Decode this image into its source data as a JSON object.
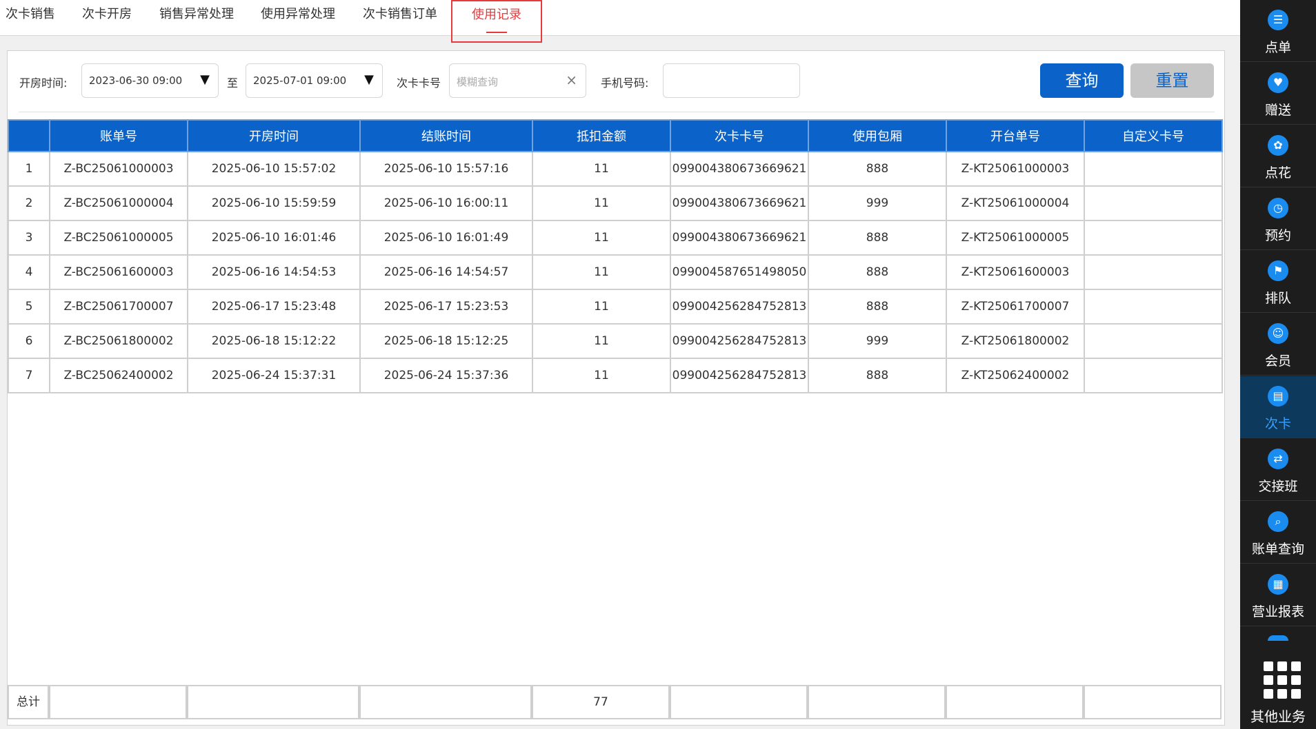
{
  "tabs": [
    {
      "label": "次卡销售"
    },
    {
      "label": "次卡开房"
    },
    {
      "label": "销售异常处理"
    },
    {
      "label": "使用异常处理"
    },
    {
      "label": "次卡销售订单"
    },
    {
      "label": "使用记录"
    }
  ],
  "filters": {
    "open_time_label": "开房时间:",
    "start": "2023-06-30 09:00",
    "to": "至",
    "end": "2025-07-01 09:00",
    "card_label": "次卡卡号",
    "card_placeholder": "模糊查询",
    "phone_label": "手机号码:",
    "phone_value": "",
    "query_label": "查询",
    "reset_label": "重置"
  },
  "table": {
    "columns": [
      "",
      "账单号",
      "开房时间",
      "结账时间",
      "抵扣金额",
      "次卡卡号",
      "使用包厢",
      "开台单号",
      "自定义卡号"
    ],
    "rows": [
      [
        "1",
        "Z-BC25061000003",
        "2025-06-10 15:57:02",
        "2025-06-10 15:57:16",
        "11",
        "099004380673669621",
        "888",
        "Z-KT25061000003",
        ""
      ],
      [
        "2",
        "Z-BC25061000004",
        "2025-06-10 15:59:59",
        "2025-06-10 16:00:11",
        "11",
        "099004380673669621",
        "999",
        "Z-KT25061000004",
        ""
      ],
      [
        "3",
        "Z-BC25061000005",
        "2025-06-10 16:01:46",
        "2025-06-10 16:01:49",
        "11",
        "099004380673669621",
        "888",
        "Z-KT25061000005",
        ""
      ],
      [
        "4",
        "Z-BC25061600003",
        "2025-06-16 14:54:53",
        "2025-06-16 14:54:57",
        "11",
        "099004587651498050",
        "888",
        "Z-KT25061600003",
        ""
      ],
      [
        "5",
        "Z-BC25061700007",
        "2025-06-17 15:23:48",
        "2025-06-17 15:23:53",
        "11",
        "099004256284752813",
        "888",
        "Z-KT25061700007",
        ""
      ],
      [
        "6",
        "Z-BC25061800002",
        "2025-06-18 15:12:22",
        "2025-06-18 15:12:25",
        "11",
        "099004256284752813",
        "999",
        "Z-KT25061800002",
        ""
      ],
      [
        "7",
        "Z-BC25062400002",
        "2025-06-24 15:37:31",
        "2025-06-24 15:37:36",
        "11",
        "099004256284752813",
        "888",
        "Z-KT25062400002",
        ""
      ]
    ],
    "total": {
      "label": "总计",
      "amount": "77"
    }
  },
  "sidebar": {
    "items": [
      {
        "label": "点单",
        "icon": "order-icon"
      },
      {
        "label": "赠送",
        "icon": "gift-icon"
      },
      {
        "label": "点花",
        "icon": "flower-icon"
      },
      {
        "label": "预约",
        "icon": "reservation-icon"
      },
      {
        "label": "排队",
        "icon": "queue-icon"
      },
      {
        "label": "会员",
        "icon": "member-icon"
      },
      {
        "label": "次卡",
        "icon": "card-icon"
      },
      {
        "label": "交接班",
        "icon": "shift-icon"
      },
      {
        "label": "账单查询",
        "icon": "bill-search-icon"
      },
      {
        "label": "营业报表",
        "icon": "report-icon"
      }
    ],
    "more_label": "其他业务",
    "active_color": "#3aa0ff"
  },
  "colors": {
    "accent": "#0b63c9",
    "active_tab": "#e8393c"
  }
}
